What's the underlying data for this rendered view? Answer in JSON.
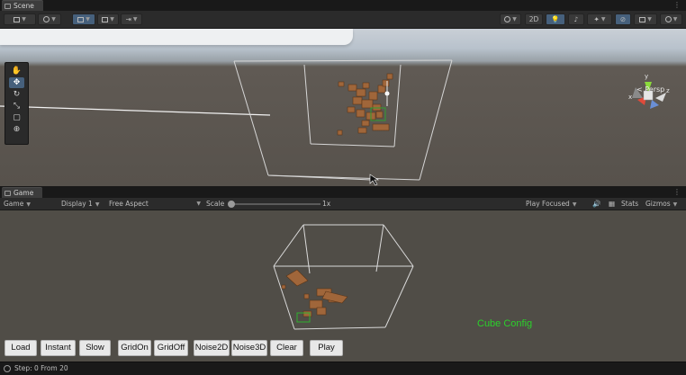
{
  "scene": {
    "tab_label": "Scene",
    "toolbar": {
      "mode_2d": "2D"
    },
    "camera_label": "< Persp",
    "gizmo_axes": {
      "y": "y",
      "x": "x",
      "z": "z"
    },
    "cube_color": "#a0663a"
  },
  "game": {
    "tab_label": "Game",
    "toolbar": {
      "view_select": "Game",
      "display_select": "Display 1",
      "aspect_select": "Free Aspect",
      "scale_label": "Scale",
      "scale_value": "1x",
      "play_mode_select": "Play Focused",
      "stats_label": "Stats",
      "gizmos_label": "Gizmos"
    },
    "overlay_title": "Cube Config",
    "overlay_color": "#2bd02b",
    "buttons": {
      "load": "Load",
      "instant": "Instant",
      "slow": "Slow",
      "grid_on": "GridOn",
      "grid_off": "GridOff",
      "noise2d": "Noise2D",
      "noise3d": "Noise3D",
      "clear": "Clear",
      "play": "Play"
    }
  },
  "status_bar": {
    "message": "Step: 0 From 20"
  }
}
